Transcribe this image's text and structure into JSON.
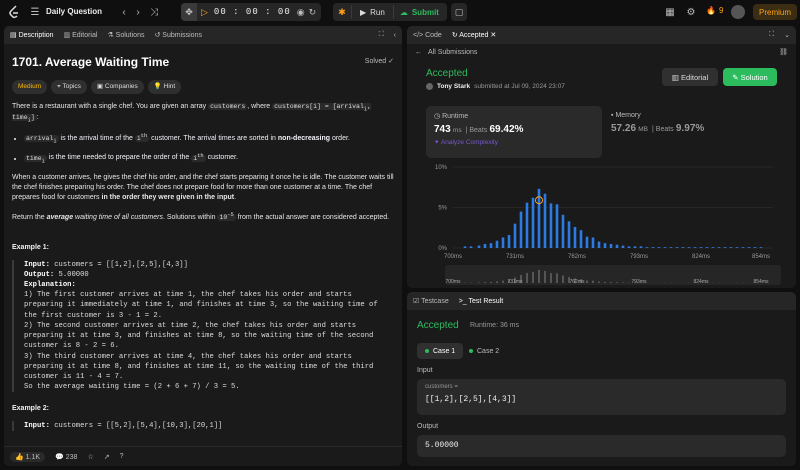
{
  "topbar": {
    "daily": "Daily Question",
    "timer": "00 : 00 : 00",
    "run": "Run",
    "submit": "Submit",
    "streak": "9",
    "premium": "Premium"
  },
  "left": {
    "tabs": [
      "Description",
      "Editorial",
      "Solutions",
      "Submissions"
    ],
    "title": "1701. Average Waiting Time",
    "solved": "Solved",
    "tags": [
      "Medium",
      "Topics",
      "Companies",
      "Hint"
    ],
    "p1a": "There is a restaurant with a single chef. You are given an array ",
    "p1b": "customers",
    "p1c": ", where ",
    "p1d": "customers[i] = [arrival",
    "p1e": "i",
    "p1f": ", time",
    "p1g": "i",
    "p1h": "]",
    "p1i": ":",
    "b1a": "arrival",
    "b1b": "i",
    "b1c": " is the arrival time of the ",
    "b1d": "i",
    "b1e": "th",
    "b1f": " customer. The arrival times are sorted in ",
    "b1g": "non-decreasing",
    "b1h": " order.",
    "b2a": "time",
    "b2b": "i",
    "b2c": " is the time needed to prepare the order of the ",
    "b2d": "i",
    "b2e": "th",
    "b2f": " customer.",
    "p2": "When a customer arrives, he gives the chef his order, and the chef starts preparing it once he is idle. The customer waits till the chef finishes preparing his order. The chef does not prepare food for more than one customer at a time. The chef prepares food for customers ",
    "p2b": "in the order they were given in the input",
    "p2c": ".",
    "p3a": "Return the ",
    "p3b": "average",
    "p3c": " waiting time of all customers",
    "p3d": ". Solutions within ",
    "p3e": "10",
    "p3f": "-5",
    "p3g": " from the actual answer are considered accepted.",
    "ex1": "Example 1:",
    "ex1_input_lbl": "Input:",
    "ex1_input": " customers = [[1,2],[2,5],[4,3]]",
    "ex1_output_lbl": "Output:",
    "ex1_output": " 5.00000",
    "ex1_expl_lbl": "Explanation:",
    "ex1_expl": "1) The first customer arrives at time 1, the chef takes his order and starts\npreparing it immediately at time 1, and finishes at time 3, so the waiting time of\nthe first customer is 3 - 1 = 2.\n2) The second customer arrives at time 2, the chef takes his order and starts\npreparing it at time 3, and finishes at time 8, so the waiting time of the second\ncustomer is 8 - 2 = 6.\n3) The third customer arrives at time 4, the chef takes his order and starts\npreparing it at time 8, and finishes at time 11, so the waiting time of the third\ncustomer is 11 - 4 = 7.\nSo the average waiting time = (2 + 6 + 7) / 3 = 5.",
    "ex2": "Example 2:",
    "ex2_input_lbl": "Input:",
    "ex2_input": " customers = [[5,2],[5,4],[10,3],[20,1]]",
    "likes": "1.1K",
    "comments": "238"
  },
  "right": {
    "tabs": [
      "Code",
      "Accepted"
    ],
    "all_sub": "All Submissions",
    "status": "Accepted",
    "user": "Tony Stark",
    "submitted": "submitted at Jul 09, 2024 23:07",
    "editorial": "Editorial",
    "solution": "Solution",
    "runtime_cap": "Runtime",
    "runtime": "743",
    "runtime_unit": "ms",
    "beats": "Beats",
    "runtime_pct": "69.42%",
    "analyze": "Analyze Complexity",
    "memory_cap": "Memory",
    "memory": "57.26",
    "memory_unit": "MB",
    "memory_pct": "9.97%",
    "testtabs": [
      "Testcase",
      "Test Result"
    ],
    "result": "Accepted",
    "result_runtime": "Runtime: 36 ms",
    "case1": "Case 1",
    "case2": "Case 2",
    "input_lbl": "Input",
    "input_name": "customers =",
    "input_val": "[[1,2],[2,5],[4,3]]",
    "output_lbl": "Output",
    "output_val": "5.00000"
  },
  "chart_data": {
    "type": "bar",
    "ylabels": [
      "10%",
      "5%",
      "0%"
    ],
    "ylim": [
      0,
      10
    ],
    "xticks": [
      "700ms",
      "731ms",
      "762ms",
      "793ms",
      "824ms",
      "854ms"
    ],
    "xlim": [
      700,
      860
    ],
    "highlight_ms": 743,
    "bar_color": "#2c7be5",
    "bars": [
      [
        706,
        0.2
      ],
      [
        709,
        0.2
      ],
      [
        713,
        0.3
      ],
      [
        716,
        0.5
      ],
      [
        719,
        0.6
      ],
      [
        722,
        0.9
      ],
      [
        725,
        1.3
      ],
      [
        728,
        1.6
      ],
      [
        731,
        3.0
      ],
      [
        734,
        4.5
      ],
      [
        737,
        5.6
      ],
      [
        740,
        6.2
      ],
      [
        743,
        7.3
      ],
      [
        746,
        6.7
      ],
      [
        749,
        5.5
      ],
      [
        752,
        5.4
      ],
      [
        755,
        4.1
      ],
      [
        758,
        3.3
      ],
      [
        761,
        2.6
      ],
      [
        764,
        2.2
      ],
      [
        767,
        1.4
      ],
      [
        770,
        1.3
      ],
      [
        773,
        0.8
      ],
      [
        776,
        0.6
      ],
      [
        779,
        0.5
      ],
      [
        782,
        0.4
      ],
      [
        785,
        0.3
      ],
      [
        788,
        0.2
      ],
      [
        791,
        0.2
      ],
      [
        794,
        0.2
      ],
      [
        797,
        0.1
      ],
      [
        800,
        0.1
      ],
      [
        803,
        0.1
      ],
      [
        806,
        0.1
      ],
      [
        809,
        0.1
      ],
      [
        812,
        0.1
      ],
      [
        815,
        0.1
      ],
      [
        818,
        0.1
      ],
      [
        821,
        0.1
      ],
      [
        824,
        0.1
      ],
      [
        827,
        0.1
      ],
      [
        830,
        0.1
      ],
      [
        833,
        0.1
      ],
      [
        836,
        0.1
      ],
      [
        839,
        0.1
      ],
      [
        842,
        0.1
      ],
      [
        845,
        0.1
      ],
      [
        848,
        0.1
      ],
      [
        851,
        0.1
      ],
      [
        854,
        0.1
      ]
    ]
  }
}
